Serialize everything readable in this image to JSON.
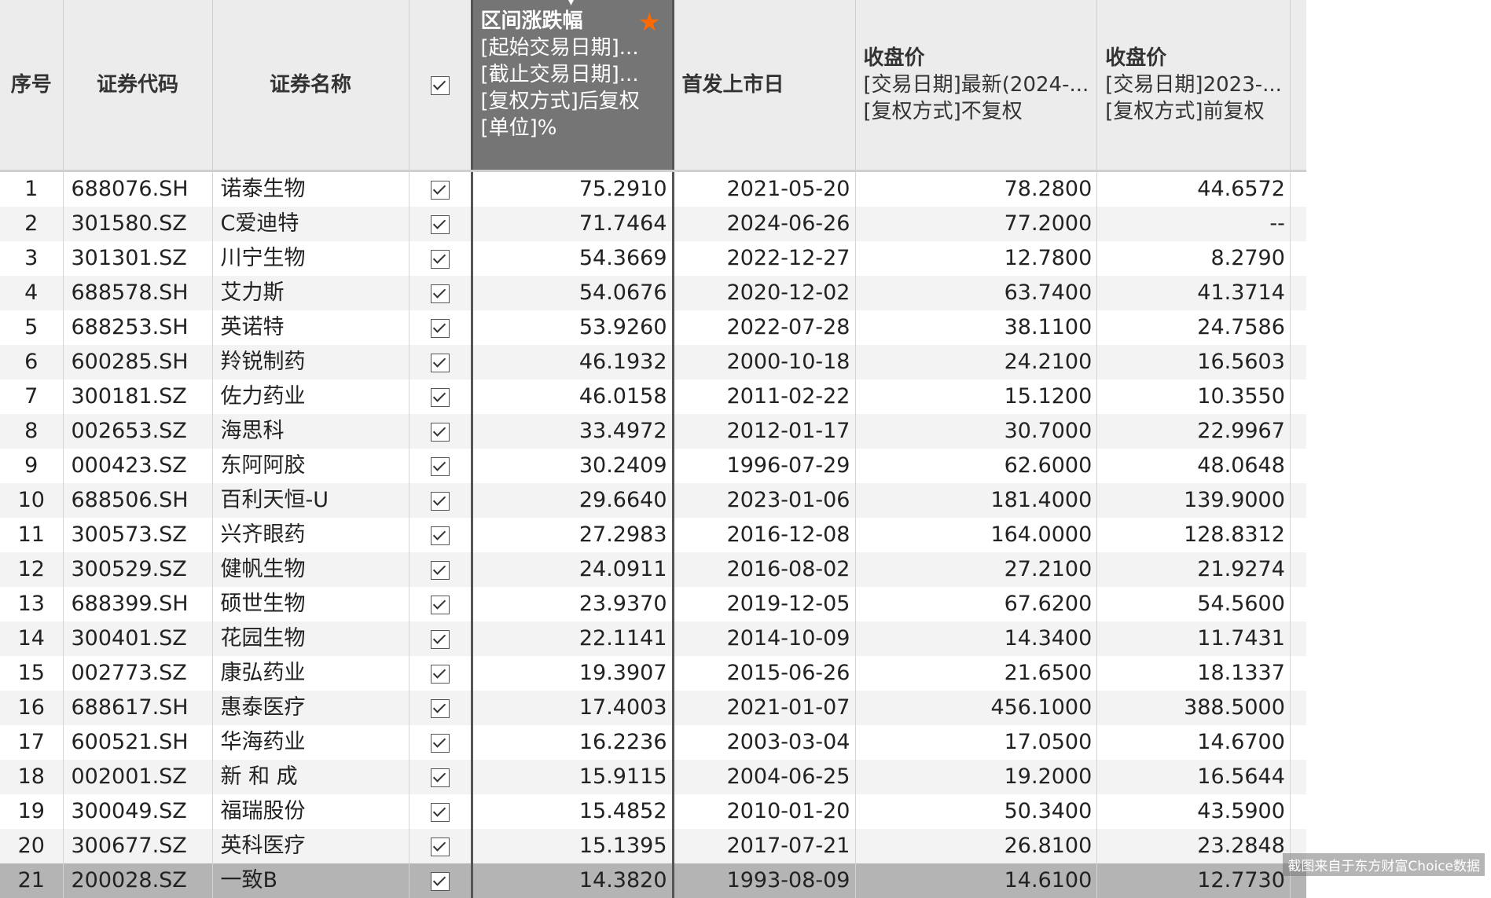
{
  "header": {
    "seq": "序号",
    "code": "证券代码",
    "name": "证券名称",
    "change": {
      "title": "区间涨跌幅",
      "lines": [
        "[起始交易日期]...",
        "[截止交易日期]...",
        "[复权方式]后复权",
        "[单位]%"
      ]
    },
    "ipo": "首发上市日",
    "close_latest": {
      "title": "收盘价",
      "lines": [
        "[交易日期]最新(2024-...",
        "[复权方式]不复权"
      ]
    },
    "close_prev": {
      "title": "收盘价",
      "lines": [
        "[交易日期]2023-...",
        "[复权方式]前复权"
      ]
    }
  },
  "colors": {
    "selected_header": "#757575",
    "star": "#ff6a00"
  },
  "rows": [
    {
      "seq": "1",
      "code": "688076.SH",
      "name": "诺泰生物",
      "change": "75.2910",
      "ipo": "2021-05-20",
      "close_latest": "78.2800",
      "close_prev": "44.6572"
    },
    {
      "seq": "2",
      "code": "301580.SZ",
      "name": "C爱迪特",
      "change": "71.7464",
      "ipo": "2024-06-26",
      "close_latest": "77.2000",
      "close_prev": "--"
    },
    {
      "seq": "3",
      "code": "301301.SZ",
      "name": "川宁生物",
      "change": "54.3669",
      "ipo": "2022-12-27",
      "close_latest": "12.7800",
      "close_prev": "8.2790"
    },
    {
      "seq": "4",
      "code": "688578.SH",
      "name": "艾力斯",
      "change": "54.0676",
      "ipo": "2020-12-02",
      "close_latest": "63.7400",
      "close_prev": "41.3714"
    },
    {
      "seq": "5",
      "code": "688253.SH",
      "name": "英诺特",
      "change": "53.9260",
      "ipo": "2022-07-28",
      "close_latest": "38.1100",
      "close_prev": "24.7586"
    },
    {
      "seq": "6",
      "code": "600285.SH",
      "name": "羚锐制药",
      "change": "46.1932",
      "ipo": "2000-10-18",
      "close_latest": "24.2100",
      "close_prev": "16.5603"
    },
    {
      "seq": "7",
      "code": "300181.SZ",
      "name": "佐力药业",
      "change": "46.0158",
      "ipo": "2011-02-22",
      "close_latest": "15.1200",
      "close_prev": "10.3550"
    },
    {
      "seq": "8",
      "code": "002653.SZ",
      "name": "海思科",
      "change": "33.4972",
      "ipo": "2012-01-17",
      "close_latest": "30.7000",
      "close_prev": "22.9967"
    },
    {
      "seq": "9",
      "code": "000423.SZ",
      "name": "东阿阿胶",
      "change": "30.2409",
      "ipo": "1996-07-29",
      "close_latest": "62.6000",
      "close_prev": "48.0648"
    },
    {
      "seq": "10",
      "code": "688506.SH",
      "name": "百利天恒-U",
      "change": "29.6640",
      "ipo": "2023-01-06",
      "close_latest": "181.4000",
      "close_prev": "139.9000"
    },
    {
      "seq": "11",
      "code": "300573.SZ",
      "name": "兴齐眼药",
      "change": "27.2983",
      "ipo": "2016-12-08",
      "close_latest": "164.0000",
      "close_prev": "128.8312"
    },
    {
      "seq": "12",
      "code": "300529.SZ",
      "name": "健帆生物",
      "change": "24.0911",
      "ipo": "2016-08-02",
      "close_latest": "27.2100",
      "close_prev": "21.9274"
    },
    {
      "seq": "13",
      "code": "688399.SH",
      "name": "硕世生物",
      "change": "23.9370",
      "ipo": "2019-12-05",
      "close_latest": "67.6200",
      "close_prev": "54.5600"
    },
    {
      "seq": "14",
      "code": "300401.SZ",
      "name": "花园生物",
      "change": "22.1141",
      "ipo": "2014-10-09",
      "close_latest": "14.3400",
      "close_prev": "11.7431"
    },
    {
      "seq": "15",
      "code": "002773.SZ",
      "name": "康弘药业",
      "change": "19.3907",
      "ipo": "2015-06-26",
      "close_latest": "21.6500",
      "close_prev": "18.1337"
    },
    {
      "seq": "16",
      "code": "688617.SH",
      "name": "惠泰医疗",
      "change": "17.4003",
      "ipo": "2021-01-07",
      "close_latest": "456.1000",
      "close_prev": "388.5000"
    },
    {
      "seq": "17",
      "code": "600521.SH",
      "name": "华海药业",
      "change": "16.2236",
      "ipo": "2003-03-04",
      "close_latest": "17.0500",
      "close_prev": "14.6700"
    },
    {
      "seq": "18",
      "code": "002001.SZ",
      "name": "新 和 成",
      "change": "15.9115",
      "ipo": "2004-06-25",
      "close_latest": "19.2000",
      "close_prev": "16.5644"
    },
    {
      "seq": "19",
      "code": "300049.SZ",
      "name": "福瑞股份",
      "change": "15.4852",
      "ipo": "2010-01-20",
      "close_latest": "50.3400",
      "close_prev": "43.5900"
    },
    {
      "seq": "20",
      "code": "300677.SZ",
      "name": "英科医疗",
      "change": "15.1395",
      "ipo": "2017-07-21",
      "close_latest": "26.8100",
      "close_prev": "23.2848"
    },
    {
      "seq": "21",
      "code": "200028.SZ",
      "name": "一致B",
      "change": "14.3820",
      "ipo": "1993-08-09",
      "close_latest": "14.6100",
      "close_prev": "12.7730"
    }
  ],
  "watermark": "截图来自于东方财富Choice数据"
}
